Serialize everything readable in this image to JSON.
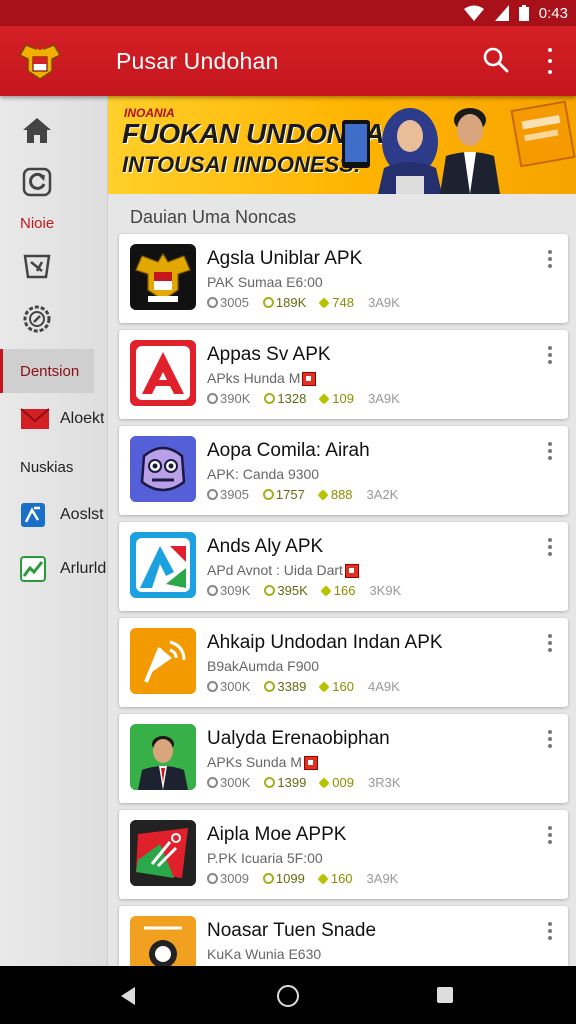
{
  "status_bar": {
    "time": "0:43"
  },
  "app_bar": {
    "title": "Pusar Undohan",
    "search_icon": "search-icon",
    "more_icon": "more-vert-icon",
    "colors": {
      "primary": "#c5161e",
      "status": "#a8101a"
    }
  },
  "sidebar": {
    "items": [
      {
        "icon": "home-icon",
        "label": ""
      },
      {
        "icon": "refresh-icon",
        "label": ""
      },
      {
        "icon": "",
        "label": "Nioie"
      },
      {
        "icon": "tag-icon",
        "label": ""
      },
      {
        "icon": "settings-icon",
        "label": ""
      },
      {
        "icon": "",
        "label": "Dentsion"
      },
      {
        "icon": "mail-icon",
        "label": "Aloekt"
      },
      {
        "icon": "",
        "label": "Nuskias"
      },
      {
        "icon": "assist-icon",
        "label": "Aoslst"
      },
      {
        "icon": "chart-icon",
        "label": "Arlurldi"
      }
    ]
  },
  "banner": {
    "small_text": "INOANIA",
    "line1": "FUOKAN UNDONSAN",
    "line2": "INTOUSAI IINDONESS!"
  },
  "list": {
    "header": "Dauian Uma Noncas",
    "apps": [
      {
        "name": "Agsla Uniblar APK",
        "sub": "PAK Sumaa E6:00",
        "downloads": "3005",
        "rating": "189K",
        "score": "748",
        "size": "3A9K",
        "icon": "garuda-emblem-icon",
        "icon_bg": "#111111"
      },
      {
        "name": "Appas Sv APK",
        "sub": "APks Hunda M",
        "downloads": "390K",
        "rating": "1328",
        "score": "109",
        "size": "3A9K",
        "icon": "letter-a-icon",
        "icon_bg": "#e0202a"
      },
      {
        "name": "Aopa Comila: Airah",
        "sub": "APK: Canda 9300",
        "downloads": "3905",
        "rating": "1757",
        "score": "888",
        "size": "3A2K",
        "icon": "robot-face-icon",
        "icon_bg": "#5560d8"
      },
      {
        "name": "Ands Aly APK",
        "sub": "APd Avnot : Uida Dart",
        "downloads": "309K",
        "rating": "395K",
        "score": "166",
        "size": "3K9K",
        "icon": "arrows-a-icon",
        "icon_bg": "#1ba0e0"
      },
      {
        "name": "Ahkaip Undodan Indan APK",
        "sub": "B9akAumda F900",
        "downloads": "300K",
        "rating": "3389",
        "score": "160",
        "size": "4A9K",
        "icon": "satellite-dish-icon",
        "icon_bg": "#f29a00"
      },
      {
        "name": "Ualyda Erenaobiphan",
        "sub": "APKs Sunda M",
        "downloads": "300K",
        "rating": "1399",
        "score": "009",
        "size": "3R3K",
        "icon": "person-portrait-icon",
        "icon_bg": "#38b048"
      },
      {
        "name": "Aipla Moe APPK",
        "sub": "P.PK Icuaria 5F:00",
        "downloads": "3009",
        "rating": "1099",
        "score": "160",
        "size": "3A9K",
        "icon": "tools-icon",
        "icon_bg": "#222222"
      },
      {
        "name": "Noasar Tuen Snade",
        "sub": "KuKa Wunia E630",
        "downloads": "",
        "rating": "",
        "score": "",
        "size": "",
        "icon": "ball-icon",
        "icon_bg": "#f2a020"
      }
    ]
  },
  "nav_bar": {
    "back_icon": "back-icon",
    "home_icon": "home-circle-icon",
    "recents_icon": "recents-icon"
  }
}
